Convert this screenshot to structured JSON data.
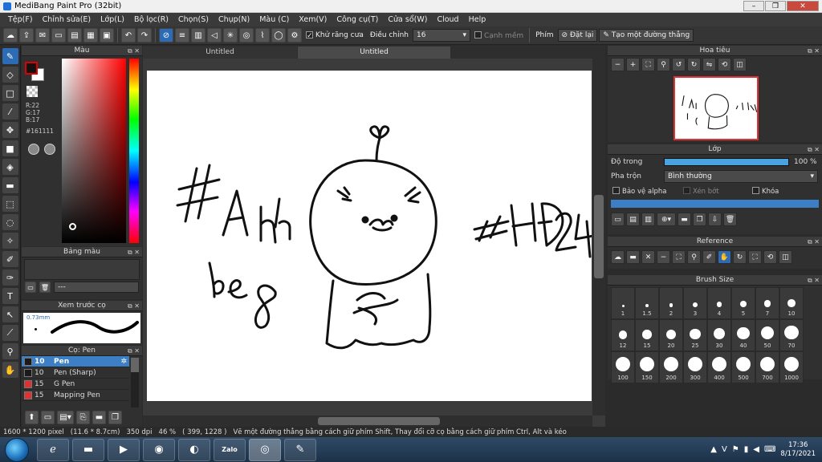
{
  "window": {
    "title": "MediBang Paint Pro (32bit)"
  },
  "menu": [
    "Tệp(F)",
    "Chỉnh sửa(E)",
    "Lớp(L)",
    "Bộ lọc(R)",
    "Chọn(S)",
    "Chụp(N)",
    "Màu (C)",
    "Xem(V)",
    "Công cụ(T)",
    "Cửa sổ(W)",
    "Cloud",
    "Help"
  ],
  "toolbar": {
    "antialias_label": "Khử răng cưa",
    "adjust_label": "Điều chỉnh",
    "adjust_value": "16",
    "snap_label": "Cạnh mềm",
    "key_label": "Phím",
    "reset_label": "Đặt lại",
    "line_label": "Tạo một đường thẳng"
  },
  "color_panel": {
    "title": "Màu",
    "r": "R:22",
    "g": "G:17",
    "b": "B:17",
    "hex": "#161111",
    "fg_color": "#161111"
  },
  "palette_panel": {
    "title": "Bảng màu",
    "value": "---"
  },
  "preview_panel": {
    "title": "Xem trước cọ",
    "size": "0.73mm"
  },
  "brush_panel": {
    "title": "Cọ: Pen",
    "items": [
      {
        "size": "10",
        "name": "Pen",
        "color": "#1a1a1a"
      },
      {
        "size": "10",
        "name": "Pen (Sharp)",
        "color": "#1a1a1a"
      },
      {
        "size": "15",
        "name": "G Pen",
        "color": "#e03030"
      },
      {
        "size": "15",
        "name": "Mapping Pen",
        "color": "#e03030"
      }
    ]
  },
  "tabs": [
    "Untitled",
    "Untitled"
  ],
  "navigator": {
    "title": "Hoa tiêu"
  },
  "layer_panel": {
    "title": "Lớp",
    "opacity_label": "Độ trong",
    "opacity_value": "100 %",
    "opacity_fraction": 1.0,
    "blend_label": "Pha trộn",
    "blend_value": "Bình thường",
    "protect_alpha": "Bảo vệ alpha",
    "clip": "Xén bớt",
    "lock": "Khóa"
  },
  "reference_panel": {
    "title": "Reference"
  },
  "brush_size_panel": {
    "title": "Brush Size",
    "sizes": [
      "1",
      "1.5",
      "2",
      "3",
      "4",
      "5",
      "7",
      "10",
      "12",
      "15",
      "20",
      "25",
      "30",
      "40",
      "50",
      "70",
      "100",
      "150",
      "200",
      "300",
      "400",
      "500",
      "700",
      "1000"
    ]
  },
  "status": {
    "dimensions": "1600 * 1200 pixel",
    "physical": "(11.6 * 8.7cm)",
    "dpi": "350 dpi",
    "zoom": "46 %",
    "coords": "( 399, 1228 )",
    "hint": "Vẽ một đường thẳng bằng cách giữ phím Shift, Thay đổi cỡ cọ bằng cách giữ phím Ctrl, Alt và kéo"
  },
  "taskbar": {
    "lang": "V",
    "time": "17:36",
    "date": "8/17/2021",
    "zalo_label": "Zalo"
  }
}
